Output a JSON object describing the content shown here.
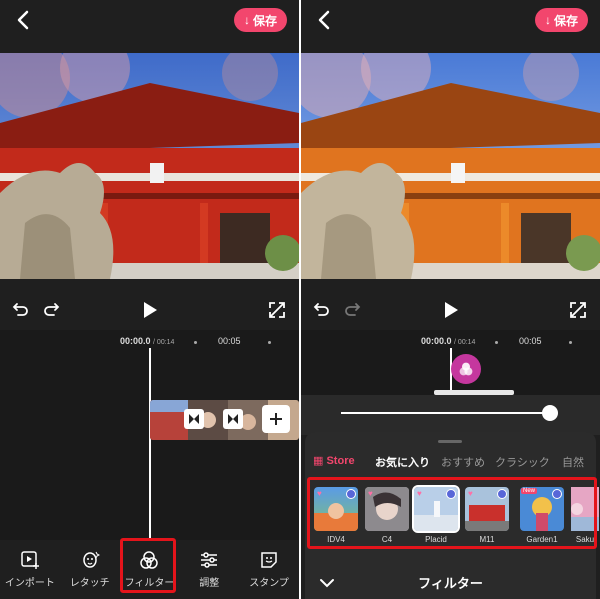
{
  "colors": {
    "accent": "#f2466d",
    "highlight": "#e4141b",
    "panel": "#1f1f1f"
  },
  "left": {
    "save_label": "保存",
    "timecode": "00:00.0",
    "duration": "/ 00:14",
    "mark_05": "00:05",
    "tools": [
      {
        "label": "インポート",
        "icon": "import-icon"
      },
      {
        "label": "レタッチ",
        "icon": "retouch-icon"
      },
      {
        "label": "フィルター",
        "icon": "filter-icon"
      },
      {
        "label": "調整",
        "icon": "adjust-icon"
      },
      {
        "label": "スタンプ",
        "icon": "sticker-icon"
      }
    ]
  },
  "right": {
    "save_label": "保存",
    "timecode": "00:00.0",
    "duration": "/ 00:14",
    "mark_05": "00:05",
    "tabs": [
      {
        "label": "Store"
      },
      {
        "label": "お気に入り"
      },
      {
        "label": "おすすめ"
      },
      {
        "label": "クラシック"
      },
      {
        "label": "自然"
      }
    ],
    "slider_value": 1.0,
    "filters": [
      {
        "name": "IDV4",
        "favorite": true,
        "selected": false,
        "new": false
      },
      {
        "name": "C4",
        "favorite": true,
        "selected": false,
        "new": false
      },
      {
        "name": "Placid",
        "favorite": true,
        "selected": true,
        "new": false
      },
      {
        "name": "M11",
        "favorite": true,
        "selected": false,
        "new": false
      },
      {
        "name": "Garden1",
        "favorite": false,
        "selected": false,
        "new": true,
        "new_label": "New"
      },
      {
        "name": "Saku",
        "favorite": false,
        "selected": false,
        "new": false
      }
    ],
    "footer_title": "フィルター"
  }
}
